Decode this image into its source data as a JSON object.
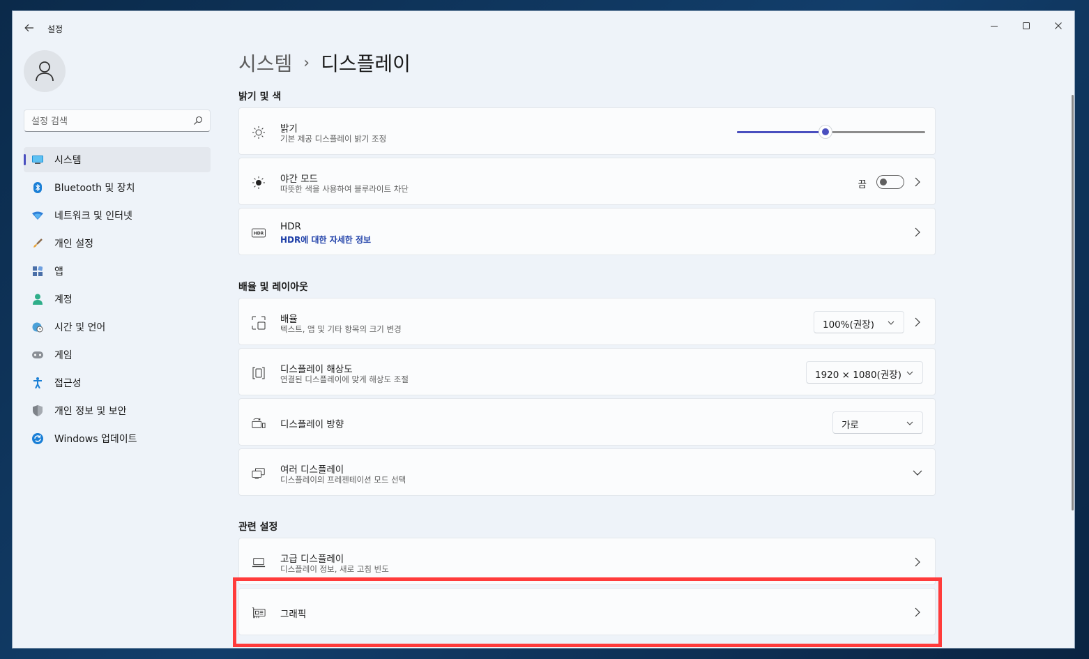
{
  "window": {
    "title": "설정"
  },
  "search": {
    "placeholder": "설정 검색"
  },
  "nav": [
    {
      "label": "시스템",
      "icon": "monitor-icon",
      "active": true
    },
    {
      "label": "Bluetooth 및 장치",
      "icon": "bluetooth-icon"
    },
    {
      "label": "네트워크 및 인터넷",
      "icon": "wifi-icon"
    },
    {
      "label": "개인 설정",
      "icon": "brush-icon"
    },
    {
      "label": "앱",
      "icon": "apps-icon"
    },
    {
      "label": "계정",
      "icon": "person-icon"
    },
    {
      "label": "시간 및 언어",
      "icon": "globe-clock-icon"
    },
    {
      "label": "게임",
      "icon": "gamepad-icon"
    },
    {
      "label": "접근성",
      "icon": "accessibility-icon"
    },
    {
      "label": "개인 정보 및 보안",
      "icon": "shield-icon"
    },
    {
      "label": "Windows 업데이트",
      "icon": "update-icon"
    }
  ],
  "breadcrumb": {
    "parent": "시스템",
    "separator": "›",
    "current": "디스플레이"
  },
  "sections": {
    "brightness_color": "밝기 및 색",
    "scale_layout": "배율 및 레이아웃",
    "related": "관련 설정"
  },
  "cards": {
    "brightness": {
      "title": "밝기",
      "sub": "기본 제공 디스플레이 밝기 조정",
      "value_percent": 47
    },
    "night_light": {
      "title": "야간 모드",
      "sub": "따뜻한 색을 사용하여 블루라이트 차단",
      "state": "끔"
    },
    "hdr": {
      "title": "HDR",
      "link": "HDR에 대한 자세한 정보"
    },
    "scale": {
      "title": "배율",
      "sub": "텍스트, 앱 및 기타 항목의 크기 변경",
      "value": "100%(권장)"
    },
    "resolution": {
      "title": "디스플레이 해상도",
      "sub": "연결된 디스플레이에 맞게 해상도 조절",
      "value": "1920 × 1080(권장)"
    },
    "orientation": {
      "title": "디스플레이 방향",
      "value": "가로"
    },
    "multiple": {
      "title": "여러 디스플레이",
      "sub": "디스플레이의 프레젠테이션 모드 선택"
    },
    "advanced": {
      "title": "고급 디스플레이",
      "sub": "디스플레이 정보, 새로 고침 빈도"
    },
    "graphics": {
      "title": "그래픽"
    }
  },
  "colors": {
    "accent": "#4a4fbf",
    "highlight": "#ff3b3b"
  }
}
